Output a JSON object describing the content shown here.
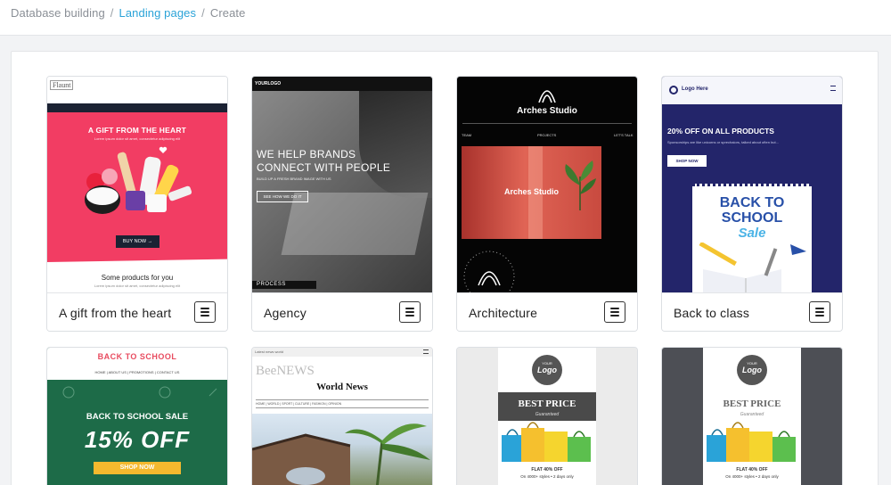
{
  "breadcrumb": {
    "item1": "Database building",
    "item2": "Landing pages",
    "item3": "Create",
    "separator": "/"
  },
  "cards": [
    {
      "name": "A gift from the heart",
      "thumb": {
        "logo": "Flaunt",
        "headline": "A GIFT FROM THE HEART",
        "sub": "Lorem ipsum dolor sit amet, consectetur adipiscing elit",
        "cta": "BUY NOW →",
        "section_title": "Some products for you",
        "section_sub": "Lorem ipsum dolor sit amet, consectetur adipiscing elit"
      }
    },
    {
      "name": "Agency",
      "thumb": {
        "logo": "YOURLOGO",
        "headline1": "WE HELP BRANDS",
        "headline2": "CONNECT WITH PEOPLE",
        "sub": "BUILD UP A FRESH BRAND IMAGE WITH US",
        "cta": "SEE HOW WE DO IT",
        "process": "PROCESS"
      }
    },
    {
      "name": "Architecture",
      "thumb": {
        "title": "Arches Studio",
        "nav1": "TEAM",
        "nav2": "PROJECTS",
        "nav3": "LET'S TALK",
        "image_title": "Arches Studio"
      }
    },
    {
      "name": "Back to class",
      "thumb": {
        "logo": "Logo Here",
        "headline": "20% OFF ON ALL PRODUCTS",
        "sub": "Sponsorships are like unicorns or sprechaiors, talked about often but...",
        "cta": "SHOP NOW",
        "art1": "BACK TO",
        "art2": "SCHOOL",
        "art3": "Sale"
      }
    },
    {
      "name": "",
      "thumb": {
        "logo": "BACK TO SCHOOL",
        "nav": "HOME | ABOUT US | PROMOTIONS | CONTACT US",
        "headline": "BACK TO SCHOOL SALE",
        "big": "15% OFF",
        "cta": "SHOP NOW"
      }
    },
    {
      "name": "",
      "thumb": {
        "top": "Latest news world",
        "logo": "BeeNEWS",
        "title": "World News",
        "nav": "HOME | WORLD | SPORT | CULTURE | FASHION | OPINION"
      }
    },
    {
      "name": "",
      "thumb": {
        "logo1": "YOUR",
        "logo2": "Logo",
        "headline": "BEST PRICE",
        "sub": "Guaranteed",
        "offer": "FLAT 40% OFF",
        "offer_sub": "On 4000+ styles • 2 days only"
      }
    },
    {
      "name": "",
      "thumb": {
        "logo1": "YOUR",
        "logo2": "Logo",
        "headline": "BEST PRICE",
        "sub": "Guaranteed",
        "offer": "FLAT 40% OFF",
        "offer_sub": "On 4000+ styles • 2 days only"
      }
    }
  ],
  "colors": {
    "link": "#2aa3d8",
    "gift_bg": "#f23d63",
    "navy": "#23256a",
    "green": "#1d6b48"
  },
  "icons": {
    "card_menu": "hamburger-menu-icon"
  }
}
